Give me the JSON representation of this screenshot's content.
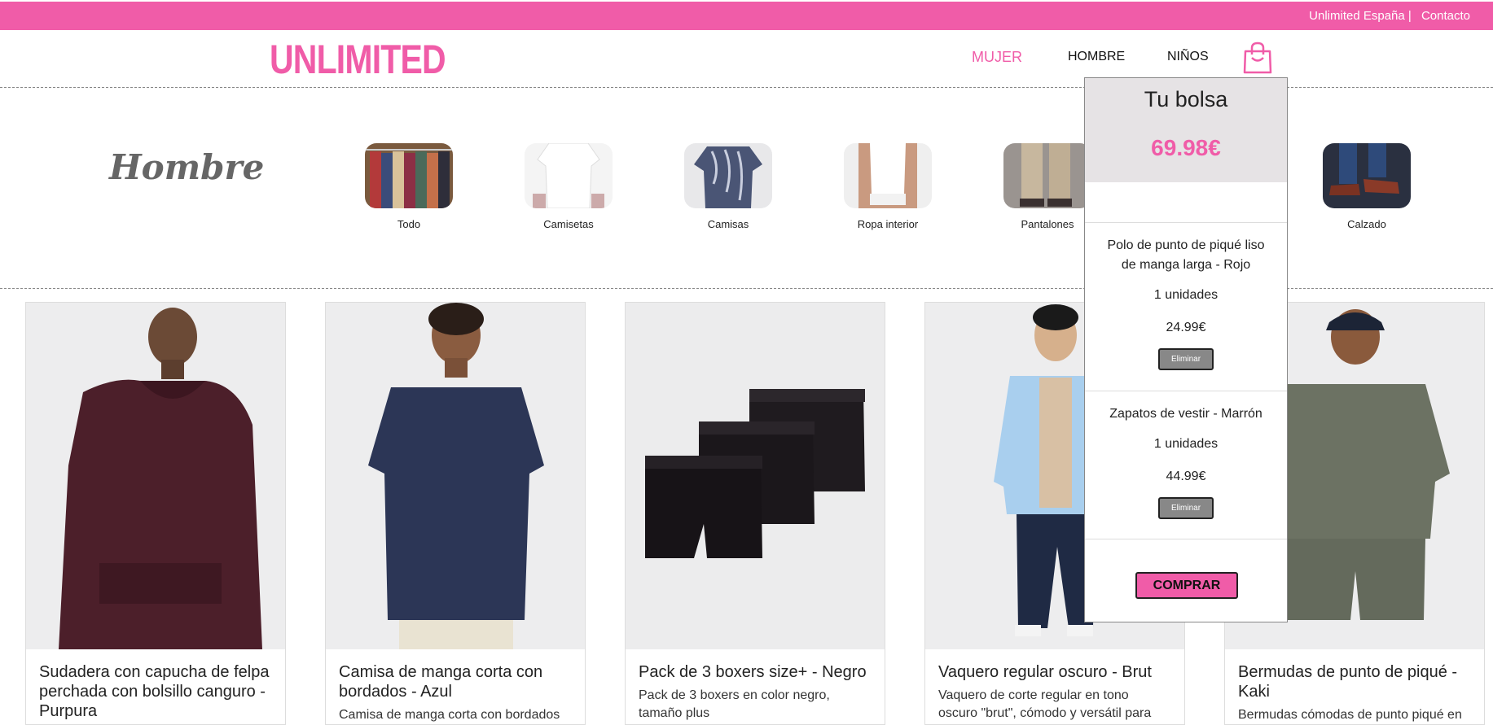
{
  "topbar": {
    "country": "Unlimited España |",
    "contact": "Contacto"
  },
  "header": {
    "logo": "UNLIMITED",
    "nav": {
      "women": "MUJER",
      "men": "HOMBRE",
      "kids": "NIÑOS"
    },
    "bag_icon": "shopping-bag-icon"
  },
  "hero": {
    "title": "Hombre",
    "categories": [
      {
        "label": "Todo"
      },
      {
        "label": "Camisetas"
      },
      {
        "label": "Camisas"
      },
      {
        "label": "Ropa interior"
      },
      {
        "label": "Pantalones"
      },
      {
        "label": "Calzado"
      }
    ]
  },
  "products": [
    {
      "title": "Sudadera con capucha de felpa perchada con bolsillo canguro - Purpura",
      "desc": ""
    },
    {
      "title": "Camisa de manga corta con bordados - Azul",
      "desc": "Camisa de manga corta con bordados"
    },
    {
      "title": "Pack de 3 boxers size+ - Negro",
      "desc": "Pack de 3 boxers en color negro, tamaño plus"
    },
    {
      "title": "Vaquero regular oscuro - Brut",
      "desc": "Vaquero de corte regular en tono oscuro \"brut\", cómodo y versátil para"
    },
    {
      "title": "Bermudas de punto de piqué - Kaki",
      "desc": "Bermudas cómodas de punto piqué en"
    }
  ],
  "bag": {
    "title": "Tu bolsa",
    "total": "69.98€",
    "items": [
      {
        "name": "Polo de punto de piqué liso de manga larga - Rojo",
        "qty": "1 unidades",
        "price": "24.99€",
        "remove": "Eliminar"
      },
      {
        "name": "Zapatos de vestir - Marrón",
        "qty": "1 unidades",
        "price": "44.99€",
        "remove": "Eliminar"
      }
    ],
    "buy": "COMPRAR"
  },
  "colors": {
    "brand": "#f05ca8",
    "panel_head": "#e6e3e5"
  }
}
